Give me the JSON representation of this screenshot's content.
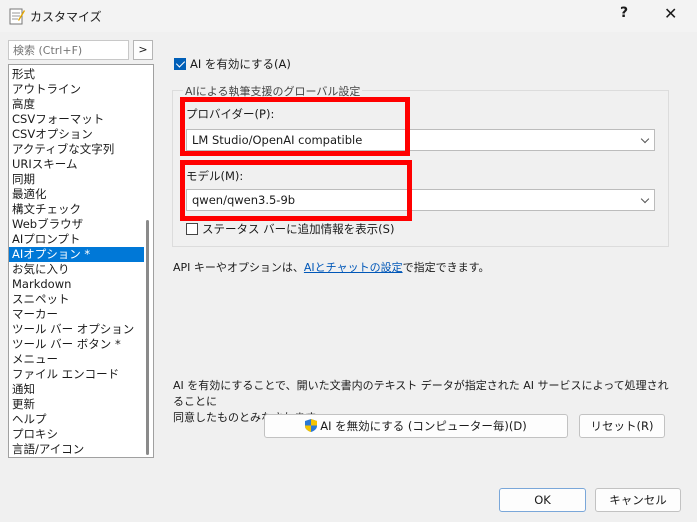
{
  "window": {
    "title": "カスタマイズ",
    "help_label": "?",
    "close_label": "✕"
  },
  "search": {
    "placeholder": "検索 (Ctrl+F)",
    "button_label": ">"
  },
  "sidebar": {
    "items": [
      {
        "label": "形式"
      },
      {
        "label": "アウトライン"
      },
      {
        "label": "高度"
      },
      {
        "label": "CSVフォーマット"
      },
      {
        "label": "CSVオプション"
      },
      {
        "label": "アクティブな文字列"
      },
      {
        "label": "URIスキーム"
      },
      {
        "label": "同期"
      },
      {
        "label": "最適化"
      },
      {
        "label": "構文チェック"
      },
      {
        "label": "Webブラウザ"
      },
      {
        "label": "AIプロンプト"
      },
      {
        "label": "AIオプション *",
        "selected": true
      },
      {
        "label": "お気に入り"
      },
      {
        "label": "Markdown"
      },
      {
        "label": "スニペット"
      },
      {
        "label": "マーカー"
      },
      {
        "label": "ツール バー オプション"
      },
      {
        "label": "ツール バー ボタン *"
      },
      {
        "label": "メニュー"
      },
      {
        "label": "ファイル エンコード"
      },
      {
        "label": "通知"
      },
      {
        "label": "更新"
      },
      {
        "label": "ヘルプ"
      },
      {
        "label": "プロキシ"
      },
      {
        "label": "言語/アイコン"
      }
    ]
  },
  "main": {
    "enable_ai_label": "AI を有効にする(A)",
    "enable_ai_checked": true,
    "group_title": "AIによる執筆支援のグローバル設定",
    "provider_label": "プロバイダー(P):",
    "provider_value": "LM Studio/OpenAI compatible",
    "model_label": "モデル(M):",
    "model_value": "qwen/qwen3.5-9b",
    "status_bar_label": "ステータス バーに追加情報を表示(S)",
    "status_bar_checked": false,
    "api_note_before": "API キーやオプションは、",
    "api_note_link": "AIとチャットの設定",
    "api_note_after": "で指定できます。",
    "disclaimer_line1": "AI を有効にすることで、開いた文書内のテキスト データが指定された AI サービスによって処理されることに",
    "disclaimer_line2": "同意したものとみなされます。",
    "disable_button_label": "AI を無効にする (コンピューター毎)(D)",
    "reset_button_label": "リセット(R)"
  },
  "footer": {
    "ok_label": "OK",
    "cancel_label": "キャンセル"
  },
  "colors": {
    "selection": "#0078d7",
    "highlight": "#ff0000",
    "link": "#0057b8"
  }
}
